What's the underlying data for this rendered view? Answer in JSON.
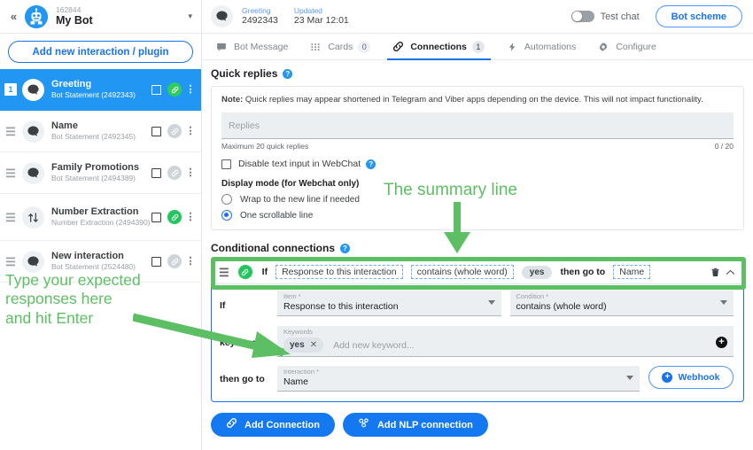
{
  "sidebar": {
    "collapse_icon": "chevron-double-left-icon",
    "bot": {
      "id": "162844",
      "name": "My Bot",
      "caret_icon": "chevron-down-icon"
    },
    "add_button_label": "Add new interaction / plugin",
    "items": [
      {
        "index": "1",
        "title": "Greeting",
        "subtitle": "Bot Statement (2492343)",
        "icon": "chat-bubble-icon",
        "link_on": true,
        "selected": true
      },
      {
        "index": "",
        "title": "Name",
        "subtitle": "Bot Statement (2492345)",
        "icon": "chat-bubble-icon",
        "link_on": false,
        "selected": false
      },
      {
        "index": "",
        "title": "Family Promotions",
        "subtitle": "Bot Statement (2494389)",
        "icon": "chat-bubble-icon",
        "link_on": false,
        "selected": false
      },
      {
        "index": "",
        "title": "Number Extraction",
        "subtitle": "Number Extraction (2494390)",
        "icon": "number-extraction-icon",
        "link_on": true,
        "selected": false
      },
      {
        "index": "",
        "title": "New interaction",
        "subtitle": "Bot Statement (2524480)",
        "icon": "chat-bubble-icon",
        "link_on": false,
        "selected": false
      }
    ]
  },
  "topbar": {
    "icon": "chat-bubble-icon",
    "name_label": "Greeting",
    "name_value": "2492343",
    "updated_label": "Updated",
    "updated_value": "23 Mar 12:01",
    "test_chat_label": "Test chat",
    "test_chat_on": false,
    "bot_scheme_label": "Bot scheme"
  },
  "tabs": [
    {
      "label": "Bot Message",
      "icon": "message-icon",
      "count": "",
      "active": false
    },
    {
      "label": "Cards",
      "icon": "grid-dots-icon",
      "count": "0",
      "active": false
    },
    {
      "label": "Connections",
      "icon": "link-icon",
      "count": "1",
      "active": true
    },
    {
      "label": "Automations",
      "icon": "lightning-icon",
      "count": "",
      "active": false
    },
    {
      "label": "Configure",
      "icon": "gear-icon",
      "count": "",
      "active": false
    }
  ],
  "quick_replies": {
    "title": "Quick replies",
    "note_prefix": "Note:",
    "note_body": " Quick replies may appear shortened in Telegram and Viber apps depending on the device. This will not impact functionality.",
    "replies_placeholder": "Replies",
    "max_hint": "Maximum 20 quick replies",
    "counter": "0 / 20",
    "disable_input_label": "Disable text input in WebChat",
    "display_mode_title": "Display mode (for Webchat only)",
    "radio_wrap_label": "Wrap to the new line if needed",
    "radio_scroll_label": "One scrollable line"
  },
  "conditional": {
    "title": "Conditional connections",
    "summary": {
      "if_label": "If",
      "item_chip": "Response to this interaction",
      "condition_chip": "contains (whole word)",
      "keyword_chip": "yes",
      "then_label": "then go to",
      "target_chip": "Name",
      "delete_icon": "trash-icon",
      "collapse_icon": "chevron-up-icon",
      "handle_icon": "drag-handle-icon",
      "link_icon": "link-icon"
    },
    "detail": {
      "if_label": "If",
      "item_field_label": "Item *",
      "item_field_value": "Response to this interaction",
      "condition_field_label": "Condition *",
      "condition_field_value": "contains (whole word)",
      "keywords_label": "keywords",
      "keywords_field_label": "Keywords",
      "keyword_chip": "yes",
      "keyword_chip_remove": "✕",
      "keywords_placeholder": "Add new keyword...",
      "add_keyword_icon": "plus-circle-icon",
      "then_label": "then go to",
      "interaction_field_label": "Interaction *",
      "interaction_field_value": "Name",
      "webhook_label": "Webhook"
    }
  },
  "bottom_buttons": [
    {
      "label": "Add Connection",
      "icon": "link-icon"
    },
    {
      "label": "Add NLP connection",
      "icon": "nlp-icon"
    }
  ],
  "annotations": {
    "summary_line": "The summary line",
    "left_line1": "Type your expected",
    "left_line2": "responses here",
    "left_line3": "and hit Enter",
    "color": "#5cbf63"
  }
}
